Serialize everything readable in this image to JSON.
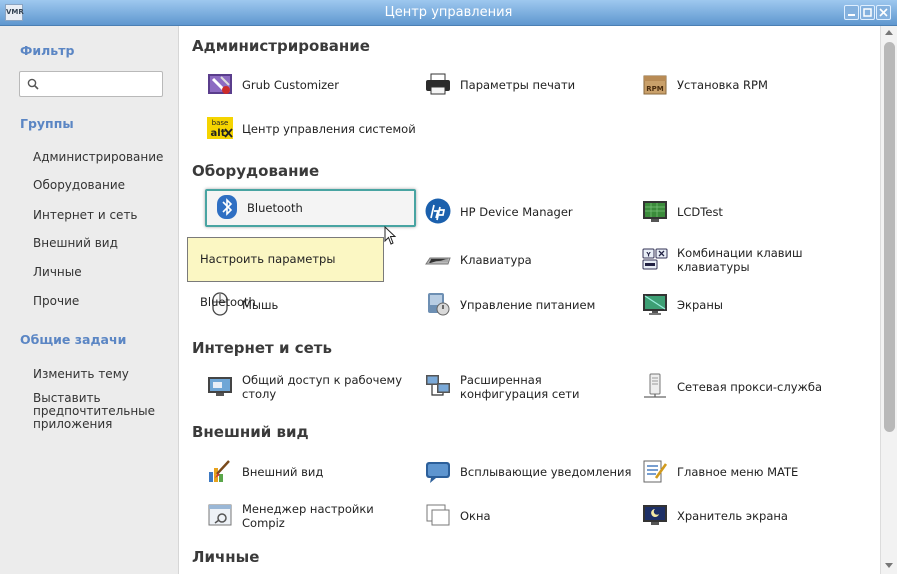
{
  "window": {
    "title": "Центр управления",
    "app_icon_text": "VMR"
  },
  "sidebar": {
    "filter_heading": "Фильтр",
    "search_value": "",
    "groups_heading": "Группы",
    "groups": [
      "Администрирование",
      "Оборудование",
      "Интернет и сеть",
      "Внешний вид",
      "Личные",
      "Прочие"
    ],
    "tasks_heading": "Общие задачи",
    "tasks": [
      "Изменить тему",
      "Выставить предпочтительные приложения"
    ]
  },
  "sections": [
    {
      "title": "Администрирование",
      "items": [
        "Grub Customizer",
        "Параметры печати",
        "Установка RPM",
        "Центр управления системой"
      ]
    },
    {
      "title": "Оборудование",
      "items": [
        "Bluetooth",
        "HP Device Manager",
        "LCDTest",
        "Клавиатура",
        "Комбинации клавиш клавиатуры",
        "Мышь",
        "Управление питанием",
        "Экраны"
      ]
    },
    {
      "title": "Интернет и сеть",
      "items": [
        "Общий доступ к рабочему столу",
        "Расширенная конфигурация сети",
        "Сетевая прокси-служба"
      ]
    },
    {
      "title": "Внешний вид",
      "items": [
        "Внешний вид",
        "Всплывающие уведомления",
        "Главное меню MATE",
        "Менеджер настройки Compiz",
        "Окна",
        "Хранитель экрана"
      ]
    },
    {
      "title": "Личные",
      "items": []
    }
  ],
  "tooltip": "Настроить параметры Bluetooth",
  "icon_texts": {
    "rpm": "RPM",
    "alt_top": "base",
    "alt_bottom": "alt"
  },
  "colors": {
    "titlebar": "#6aa2d8",
    "heading_blue": "#5b86c4",
    "selection_border": "#48a4a2",
    "tooltip_bg": "#fbf7c3"
  }
}
